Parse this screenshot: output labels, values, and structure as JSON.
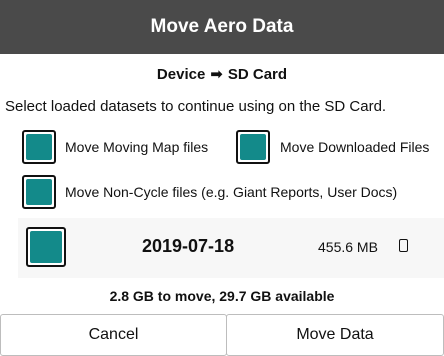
{
  "dialog": {
    "title": "Move Aero Data",
    "subtitle_from": "Device",
    "subtitle_arrow": "➡",
    "subtitle_to": "SD Card",
    "instruction": "Select loaded datasets to continue using on the SD Card."
  },
  "options": {
    "moving_map": {
      "label": "Move Moving Map files",
      "checked": true
    },
    "downloaded": {
      "label": "Move Downloaded Files",
      "checked": true
    },
    "non_cycle": {
      "label": "Move Non-Cycle files (e.g. Giant Reports, User Docs)",
      "checked": true
    }
  },
  "datasets": [
    {
      "date": "2019-07-18",
      "size": "455.6 MB",
      "checked": true,
      "icon": "phone-device-icon"
    }
  ],
  "summary": "2.8 GB to move, 29.7 GB available",
  "buttons": {
    "cancel": "Cancel",
    "move": "Move Data"
  },
  "colors": {
    "title_bar": "#4a4a4a",
    "checkbox_fill": "#138a8a"
  }
}
